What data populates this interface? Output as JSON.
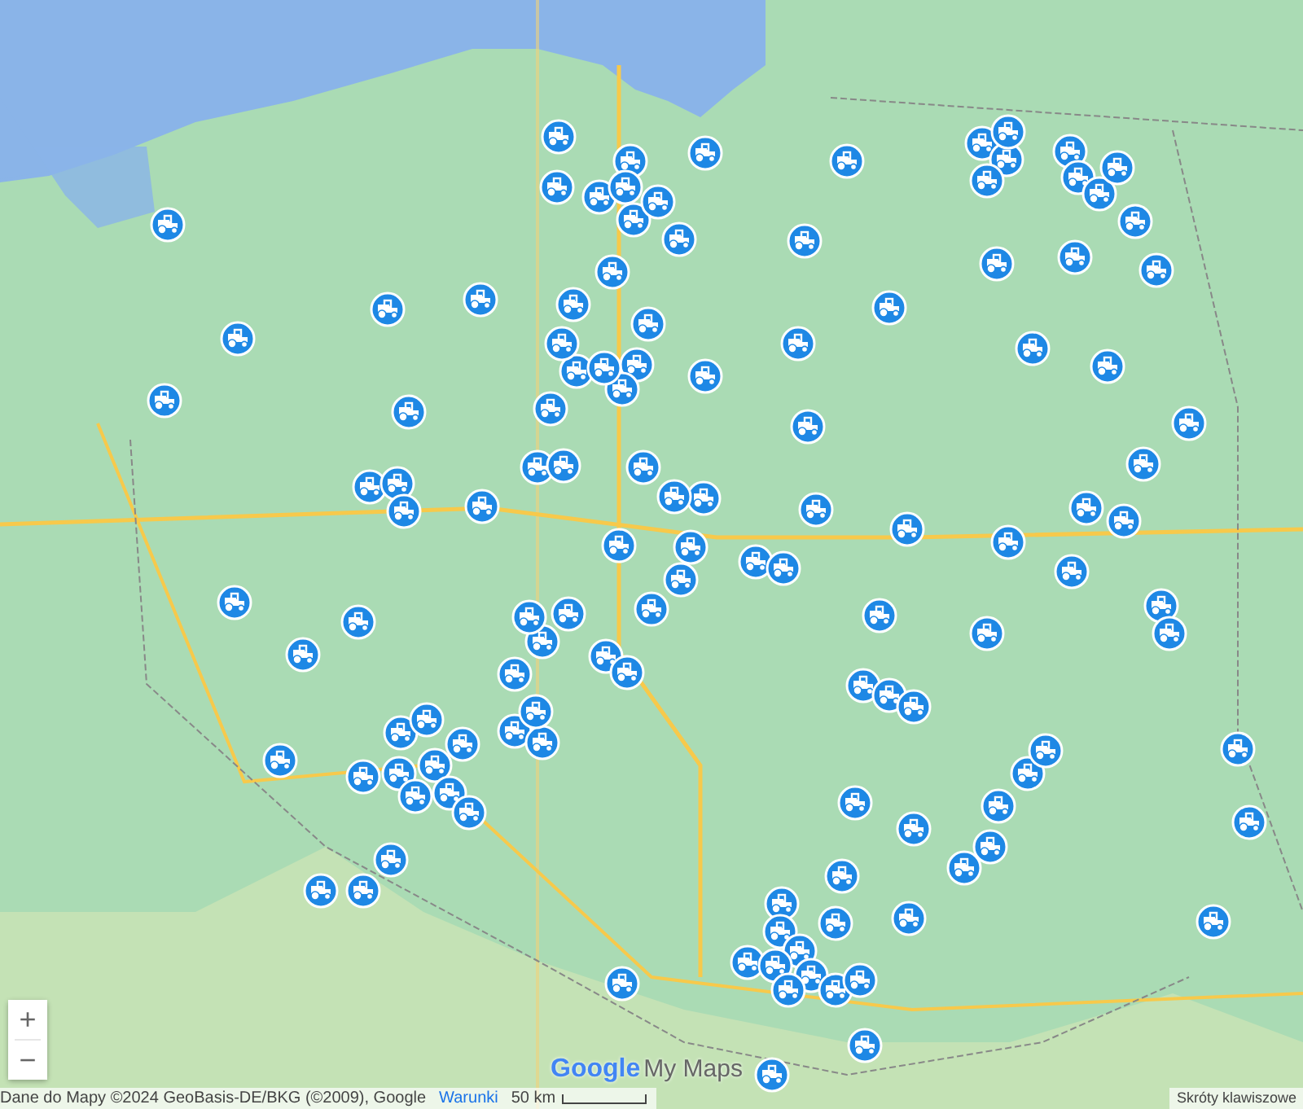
{
  "map": {
    "zoom_controls": [
      {
        "label": "+"
      },
      {
        "label": "−"
      }
    ],
    "logo": {
      "brand": "Google",
      "product": "My Maps"
    },
    "attribution": {
      "data": "Dane do Mapy ©2024 GeoBasis-DE/BKG (©2009), Google",
      "terms": "Warunki",
      "scale": "50 km",
      "shortcuts": "Skróty klawiszowe"
    }
  }
}
